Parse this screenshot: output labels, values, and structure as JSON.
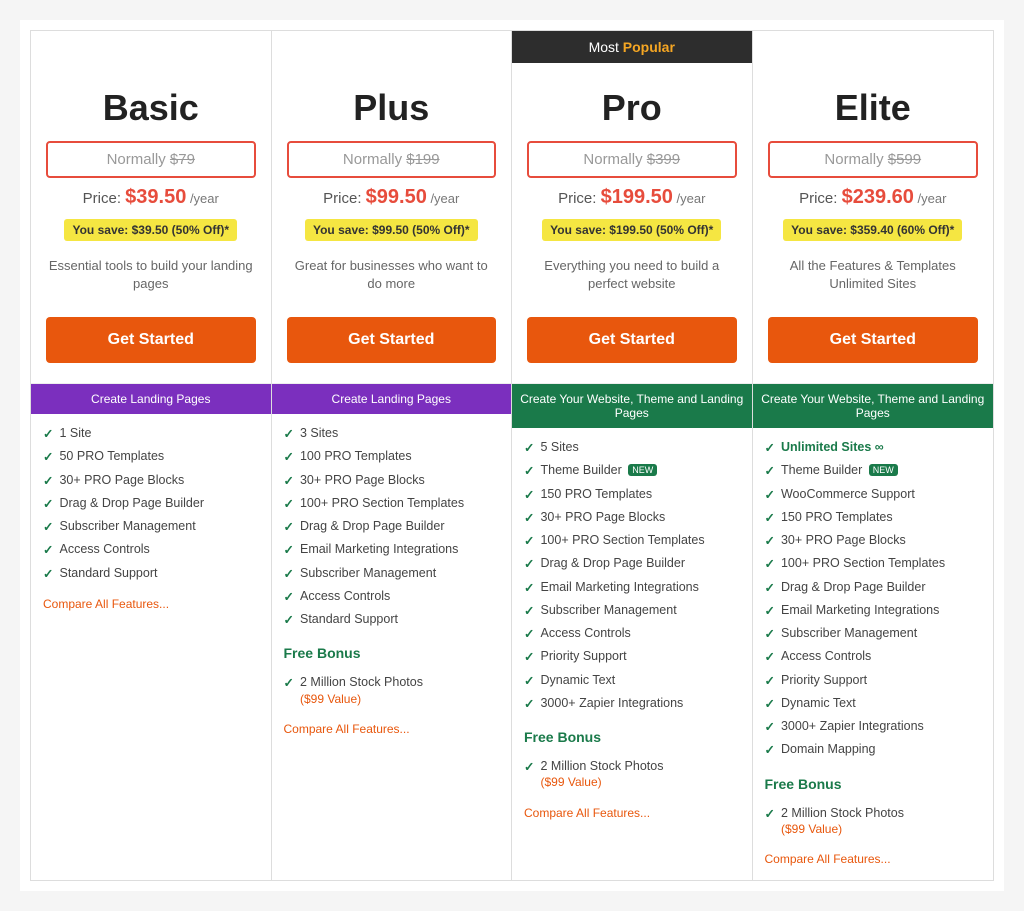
{
  "plans": [
    {
      "id": "basic",
      "name": "Basic",
      "normally": "$79",
      "price": "$39.50",
      "savings": "You save: $39.50 (50% Off)*",
      "description": "Essential tools to build your landing pages",
      "sectionHeader": "Create Landing Pages",
      "sectionColor": "purple",
      "features": [
        {
          "text": "1 Site",
          "bold": false
        },
        {
          "text": "50 PRO Templates",
          "bold": false
        },
        {
          "text": "30+ PRO Page Blocks",
          "bold": false
        },
        {
          "text": "Drag & Drop Page Builder",
          "bold": false
        },
        {
          "text": "Subscriber Management",
          "bold": false
        },
        {
          "text": "Access Controls",
          "bold": false
        },
        {
          "text": "Standard Support",
          "bold": false
        }
      ],
      "freeBonus": false,
      "compareLink": "Compare All Features..."
    },
    {
      "id": "plus",
      "name": "Plus",
      "normally": "$199",
      "price": "$99.50",
      "savings": "You save: $99.50 (50% Off)*",
      "description": "Great for businesses who want to do more",
      "sectionHeader": "Create Landing Pages",
      "sectionColor": "purple",
      "features": [
        {
          "text": "3 Sites",
          "bold": false
        },
        {
          "text": "100 PRO Templates",
          "bold": false
        },
        {
          "text": "30+ PRO Page Blocks",
          "bold": false
        },
        {
          "text": "100+ PRO Section Templates",
          "bold": false
        },
        {
          "text": "Drag & Drop Page Builder",
          "bold": false
        },
        {
          "text": "Email Marketing Integrations",
          "bold": false
        },
        {
          "text": "Subscriber Management",
          "bold": false
        },
        {
          "text": "Access Controls",
          "bold": false
        },
        {
          "text": "Standard Support",
          "bold": false
        }
      ],
      "freeBonus": true,
      "bonusItems": [
        {
          "text": "2 Million Stock Photos",
          "value": "($99 Value)"
        }
      ],
      "compareLink": "Compare All Features..."
    },
    {
      "id": "pro",
      "name": "Pro",
      "normally": "$399",
      "price": "$199.50",
      "savings": "You save: $199.50 (50% Off)*",
      "description": "Everything you need to build a perfect website",
      "sectionHeader": "Create Your Website, Theme and Landing Pages",
      "sectionColor": "green",
      "mostPopular": true,
      "features": [
        {
          "text": "5 Sites",
          "bold": false
        },
        {
          "text": "Theme Builder",
          "bold": false,
          "badge": "NEW"
        },
        {
          "text": "150 PRO Templates",
          "bold": false
        },
        {
          "text": "30+ PRO Page Blocks",
          "bold": false
        },
        {
          "text": "100+ PRO Section Templates",
          "bold": false
        },
        {
          "text": "Drag & Drop Page Builder",
          "bold": false
        },
        {
          "text": "Email Marketing Integrations",
          "bold": false
        },
        {
          "text": "Subscriber Management",
          "bold": false
        },
        {
          "text": "Access Controls",
          "bold": false
        },
        {
          "text": "Priority Support",
          "bold": false
        },
        {
          "text": "Dynamic Text",
          "bold": false
        },
        {
          "text": "3000+ Zapier Integrations",
          "bold": false
        }
      ],
      "freeBonus": true,
      "bonusItems": [
        {
          "text": "2 Million Stock Photos",
          "value": "($99 Value)"
        }
      ],
      "compareLink": "Compare All Features..."
    },
    {
      "id": "elite",
      "name": "Elite",
      "normally": "$599",
      "price": "$239.60",
      "savings": "You save: $359.40 (60% Off)*",
      "description": "All the Features & Templates Unlimited Sites",
      "sectionHeader": "Create Your Website, Theme and Landing Pages",
      "sectionColor": "green",
      "features": [
        {
          "text": "Unlimited Sites ∞",
          "bold": false,
          "green": true
        },
        {
          "text": "Theme Builder",
          "bold": false,
          "badge": "NEW"
        },
        {
          "text": "WooCommerce Support",
          "bold": false
        },
        {
          "text": "150 PRO Templates",
          "bold": false
        },
        {
          "text": "30+ PRO Page Blocks",
          "bold": false
        },
        {
          "text": "100+ PRO Section Templates",
          "bold": false
        },
        {
          "text": "Drag & Drop Page Builder",
          "bold": false
        },
        {
          "text": "Email Marketing Integrations",
          "bold": false
        },
        {
          "text": "Subscriber Management",
          "bold": false
        },
        {
          "text": "Access Controls",
          "bold": false
        },
        {
          "text": "Priority Support",
          "bold": false
        },
        {
          "text": "Dynamic Text",
          "bold": false
        },
        {
          "text": "3000+ Zapier Integrations",
          "bold": false
        },
        {
          "text": "Domain Mapping",
          "bold": false
        }
      ],
      "freeBonus": true,
      "bonusItems": [
        {
          "text": "2 Million Stock Photos",
          "value": "($99 Value)"
        }
      ],
      "compareLink": "Compare All Features..."
    }
  ],
  "buttons": {
    "getStarted": "Get Started"
  },
  "mostPopular": {
    "label": "Most",
    "highlight": "Popular"
  }
}
